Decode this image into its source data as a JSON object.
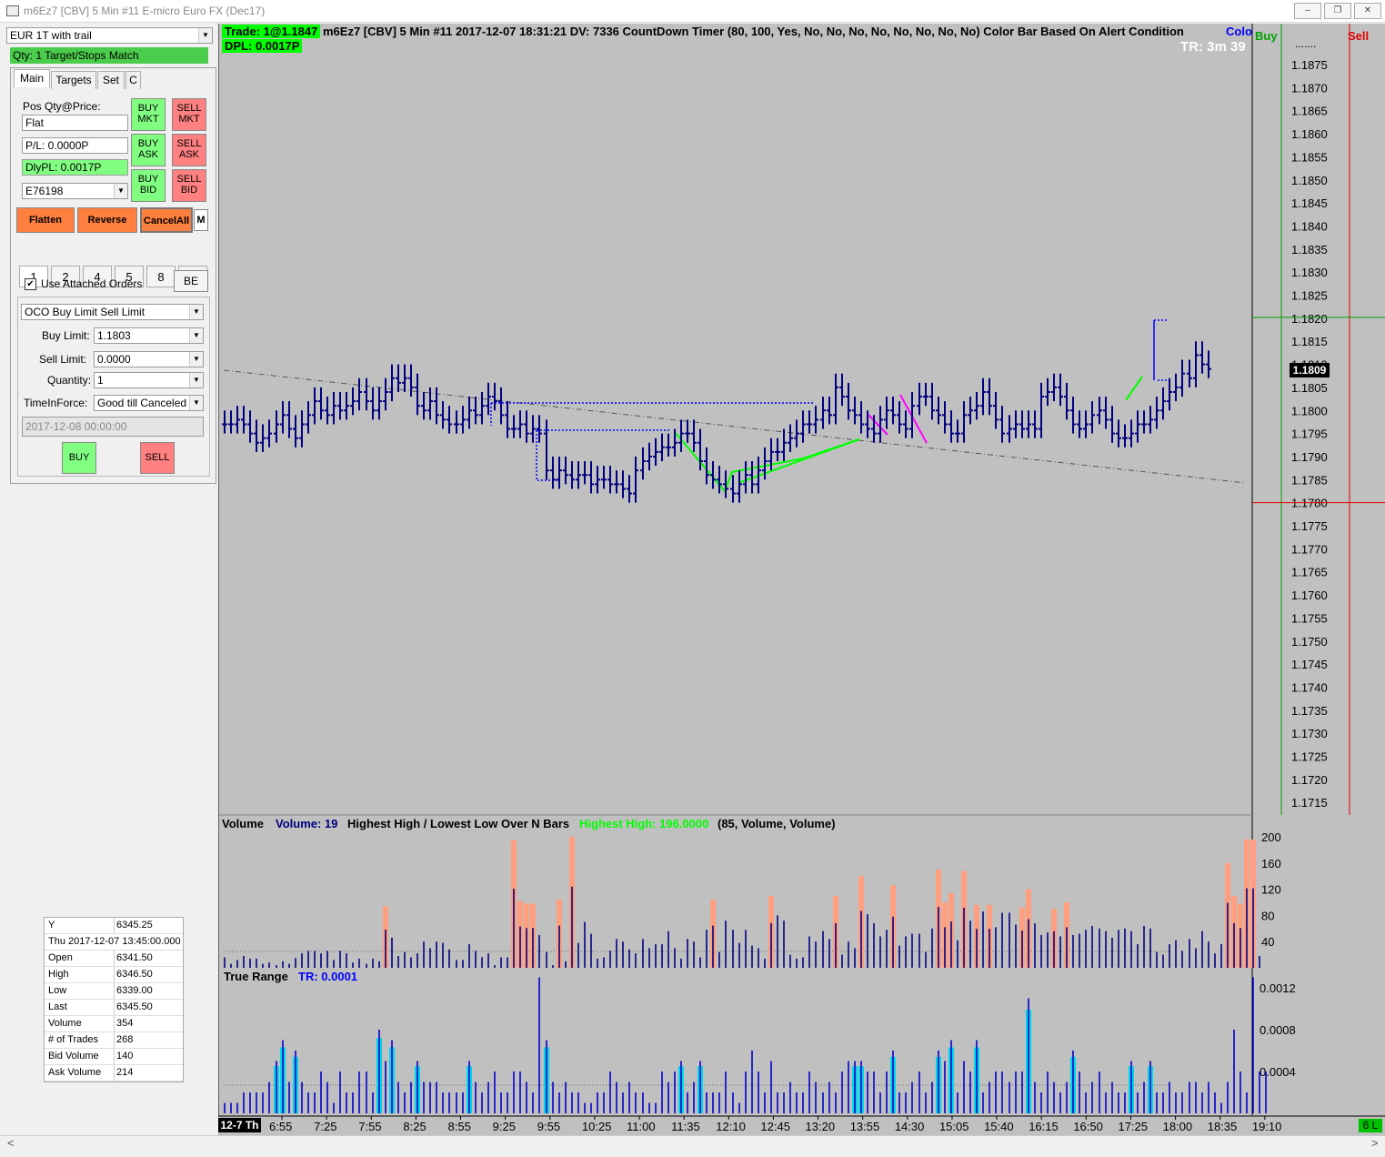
{
  "window": {
    "title": "m6Ez7 [CBV]  5 Min   #11  E-micro Euro FX (Dec17)",
    "buttons": [
      "–",
      "❐",
      "✕"
    ]
  },
  "order_panel": {
    "strategy_select": "EUR 1T with trail",
    "status_bar": "Qty: 1 Target/Stops Match",
    "tabs": [
      "Main",
      "Targets",
      "Set",
      "C"
    ],
    "pos_label": "Pos Qty@Price:",
    "pos_value": "Flat",
    "pl_value": "P/L: 0.0000P",
    "dlypl_value": "DlyPL: 0.0017P",
    "account": "E76198",
    "buy_mkt": [
      "BUY",
      "MKT"
    ],
    "sell_mkt": [
      "SELL",
      "MKT"
    ],
    "buy_ask": [
      "BUY",
      "ASK"
    ],
    "sell_ask": [
      "SELL",
      "ASK"
    ],
    "buy_bid": [
      "BUY",
      "BID"
    ],
    "sell_bid": [
      "SELL",
      "BID"
    ],
    "flatten": "Flatten",
    "reverse": "Reverse",
    "cancel_all": "CancelAll",
    "m_button": "M",
    "qty_buttons": [
      "1",
      "2",
      "4",
      "5",
      "8",
      "0"
    ],
    "use_attached_label": "Use Attached Orders",
    "use_attached_checked": true,
    "be_button": "BE",
    "order_type": "OCO Buy Limit Sell Limit",
    "buy_limit_label": "Buy Limit:",
    "buy_limit_value": "1.1803",
    "sell_limit_label": "Sell Limit:",
    "sell_limit_value": "0.0000",
    "quantity_label": "Quantity:",
    "quantity_value": "1",
    "tif_label": "TimeInForce:",
    "tif_value": "Good till Canceled",
    "date_value": "2017-12-08  00:00:00",
    "buy_button": "BUY",
    "sell_button": "SELL"
  },
  "data_box": {
    "header_k": "Y",
    "header_v": "6345.25",
    "date_row": "Thu 2017-12-07   13:45:00.000",
    "rows": [
      {
        "k": "Open",
        "v": "6341.50"
      },
      {
        "k": "High",
        "v": "6346.50"
      },
      {
        "k": "Low",
        "v": "6339.00"
      },
      {
        "k": "Last",
        "v": "6345.50"
      },
      {
        "k": "Volume",
        "v": "354"
      },
      {
        "k": "# of Trades",
        "v": "268"
      },
      {
        "k": "Bid Volume",
        "v": "140"
      },
      {
        "k": "Ask Volume",
        "v": "214"
      }
    ]
  },
  "chart": {
    "trade_label": "Trade: 1@1.1847",
    "header_text": " m6Ez7 [CBV]  5 Min    #11 2017-12-07  18:31:21 DV: 7336  CountDown Timer    (80, 100, Yes, No, No, No, No, No, No, No, No)  Color Bar Based On Alert Condition",
    "header_trunc": "Colo",
    "dpl_label": "DPL: 0.0017P",
    "timer": "TR: 3m 39",
    "buy_label": "Buy",
    "sell_label": "Sell",
    "current_price": "1.1809",
    "price_axis": [
      "1.1875",
      "1.1870",
      "1.1865",
      "1.1860",
      "1.1855",
      "1.1850",
      "1.1845",
      "1.1840",
      "1.1835",
      "1.1830",
      "1.1825",
      "1.1820",
      "1.1815",
      "1.1810",
      "1.1805",
      "1.1800",
      "1.1795",
      "1.1790",
      "1.1785",
      "1.1780",
      "1.1775",
      "1.1770",
      "1.1765",
      "1.1760",
      "1.1755",
      "1.1750",
      "1.1745",
      "1.1740",
      "1.1735",
      "1.1730",
      "1.1725",
      "1.1720",
      "1.1715"
    ],
    "volume_header": {
      "name": "Volume",
      "study": "Volume: 19",
      "hhll": "Highest High / Lowest Low Over N Bars",
      "hh": "Highest High: 196.0000",
      "params": "(85, Volume, Volume)"
    },
    "volume_axis": [
      "200",
      "160",
      "120",
      "80",
      "40"
    ],
    "tr_header": {
      "name": "True Range",
      "value": "TR: 0.0001"
    },
    "tr_axis": [
      "0.0012",
      "0.0008",
      "0.0004"
    ],
    "time_axis_date": "12-7 Th",
    "time_axis": [
      "6:55",
      "7:25",
      "7:55",
      "8:25",
      "8:55",
      "9:25",
      "9:55",
      "10:25",
      "11:00",
      "11:35",
      "12:10",
      "12:45",
      "13:20",
      "13:55",
      "14:30",
      "15:05",
      "15:40",
      "16:15",
      "16:50",
      "17:25",
      "18:00",
      "18:35",
      "19:10"
    ],
    "corner_label": "6 L",
    "colors": {
      "bg": "#c0c0c0",
      "bar": "#000080",
      "green": "#00ff00",
      "magenta": "#ff00ff",
      "salmon": "#ff9f7f",
      "cyan": "#00d8e8",
      "blue": "#0000ff"
    }
  },
  "chart_data": {
    "type": "bar",
    "title": "m6Ez7 [CBV] 5 Min",
    "xlabel": "",
    "ylabel": "",
    "ylim": [
      1.1715,
      1.1878
    ],
    "series": [
      {
        "name": "Volume: 19",
        "values": [
          16,
          6,
          12,
          18,
          14,
          14,
          6,
          8,
          4,
          10,
          6,
          15,
          22,
          26,
          26,
          22,
          26,
          12,
          26,
          22,
          8,
          14,
          6,
          14,
          10,
          94,
          46,
          18,
          24,
          16,
          22,
          40,
          30,
          40,
          38,
          28,
          12,
          12,
          36,
          26,
          16,
          22,
          4,
          16,
          16,
          195,
          102,
          98,
          98,
          50,
          24,
          4,
          104,
          10,
          200,
          38,
          70,
          52,
          14,
          16,
          26,
          44,
          40,
          28,
          22,
          44,
          30,
          36,
          36,
          56,
          30,
          14,
          44,
          40,
          16,
          58,
          104,
          24,
          72,
          58,
          38,
          58,
          34,
          30,
          14,
          110,
          80,
          72,
          20,
          14,
          16,
          48,
          40,
          56,
          44,
          110,
          20,
          40,
          30,
          140,
          82,
          68,
          48,
          58,
          126,
          34,
          48,
          52,
          52,
          24,
          60,
          150,
          100,
          114,
          42,
          148,
          72,
          96,
          86,
          96,
          62,
          84,
          84,
          66,
          92,
          120,
          68,
          50,
          54,
          90,
          48,
          100,
          50,
          52,
          58,
          64,
          60,
          56,
          46,
          58,
          60,
          56,
          36,
          64,
          60,
          24,
          20,
          36,
          42,
          26,
          44,
          30,
          56,
          40,
          22,
          36,
          160,
          110,
          98,
          196,
          196,
          18
        ]
      },
      {
        "name": "TR: 0.0001",
        "values": [
          0.0001,
          0.0001,
          0.0001,
          0.0002,
          0.0002,
          0.0002,
          0.0002,
          0.0003,
          0.0005,
          0.0007,
          0.0003,
          0.0006,
          0.0003,
          0.0002,
          0.0002,
          0.0004,
          0.0003,
          0.0001,
          0.0004,
          0.0002,
          0.0002,
          0.0004,
          0.0004,
          0.0002,
          0.0008,
          0.0005,
          0.0007,
          0.0003,
          0.0002,
          0.0003,
          0.0005,
          0.0003,
          0.0003,
          0.0003,
          0.0002,
          0.0002,
          0.0002,
          0.0002,
          0.0005,
          0.0003,
          0.0002,
          0.0003,
          0.0004,
          0.0002,
          0.0002,
          0.0004,
          0.0004,
          0.0003,
          0.0002,
          0.0013,
          0.0007,
          0.0003,
          0.0002,
          0.0003,
          0.0002,
          0.0002,
          0.0001,
          0.0001,
          0.0002,
          0.0002,
          0.0004,
          0.0003,
          0.0002,
          0.0003,
          0.0002,
          0.0002,
          0.0001,
          0.0001,
          0.0004,
          0.0003,
          0.0004,
          0.0005,
          0.0002,
          0.0003,
          0.0005,
          0.0002,
          0.0002,
          0.0002,
          0.0004,
          0.0002,
          0.0001,
          0.0004,
          0.0006,
          0.0004,
          0.0002,
          0.0005,
          0.0002,
          0.0002,
          0.0003,
          0.0002,
          0.0002,
          0.0004,
          0.0003,
          0.0002,
          0.0003,
          0.0002,
          0.0004,
          0.0005,
          0.0005,
          0.0005,
          0.0004,
          0.0004,
          0.0002,
          0.0004,
          0.0006,
          0.0002,
          0.0002,
          0.0003,
          0.0004,
          0.0002,
          0.0003,
          0.0006,
          0.0005,
          0.0007,
          0.0002,
          0.0005,
          0.0004,
          0.0007,
          0.0002,
          0.0003,
          0.0004,
          0.0004,
          0.0003,
          0.0004,
          0.0004,
          0.0011,
          0.0003,
          0.0002,
          0.0004,
          0.0003,
          0.0002,
          0.0003,
          0.0006,
          0.0004,
          0.0002,
          0.0003,
          0.0004,
          0.0002,
          0.0003,
          0.0002,
          0.0002,
          0.0005,
          0.0002,
          0.0003,
          0.0005,
          0.0002,
          0.0002,
          0.0003,
          0.0002,
          0.0002,
          0.0003,
          0.0003,
          0.0002,
          0.0003,
          0.0002,
          0.0001,
          0.0003,
          0.0008,
          0.0004,
          0.0002,
          0.0013,
          0.0004,
          0.0004
        ]
      }
    ],
    "price_path": [
      1.1797,
      1.1797,
      1.1798,
      1.1797,
      1.1795,
      1.1793,
      1.1794,
      1.1795,
      1.1797,
      1.1799,
      1.1796,
      1.1794,
      1.1797,
      1.1799,
      1.1802,
      1.18,
      1.1799,
      1.1801,
      1.18,
      1.1801,
      1.1802,
      1.1804,
      1.1802,
      1.18,
      1.1802,
      1.1804,
      1.1807,
      1.1806,
      1.1807,
      1.1805,
      1.1801,
      1.18,
      1.1802,
      1.1799,
      1.1798,
      1.1797,
      1.1797,
      1.1798,
      1.18,
      1.1799,
      1.1801,
      1.1803,
      1.1802,
      1.1799,
      1.1796,
      1.1796,
      1.1797,
      1.1795,
      1.1796,
      1.1795,
      1.1787,
      1.1785,
      1.1787,
      1.1786,
      1.1785,
      1.1786,
      1.1786,
      1.1784,
      1.1785,
      1.1785,
      1.1784,
      1.1784,
      1.1783,
      1.1782,
      1.1787,
      1.1789,
      1.179,
      1.1791,
      1.1792,
      1.1792,
      1.1793,
      1.1795,
      1.1795,
      1.1793,
      1.1789,
      1.1786,
      1.1785,
      1.1784,
      1.1783,
      1.1782,
      1.1784,
      1.1786,
      1.1784,
      1.1787,
      1.1789,
      1.1791,
      1.1791,
      1.1793,
      1.1794,
      1.1795,
      1.1797,
      1.1797,
      1.1798,
      1.18,
      1.1799,
      1.1805,
      1.1803,
      1.18,
      1.1799,
      1.1797,
      1.1796,
      1.1795,
      1.1798,
      1.18,
      1.1799,
      1.1797,
      1.1796,
      1.1801,
      1.1803,
      1.1803,
      1.18,
      1.1799,
      1.1797,
      1.1795,
      1.1795,
      1.1799,
      1.18,
      1.1801,
      1.1804,
      1.1801,
      1.1798,
      1.1795,
      1.1796,
      1.1797,
      1.1796,
      1.1797,
      1.1796,
      1.1803,
      1.1804,
      1.1805,
      1.1803,
      1.18,
      1.1797,
      1.1796,
      1.1797,
      1.1799,
      1.18,
      1.1798,
      1.1795,
      1.1794,
      1.1794,
      1.1795,
      1.1797,
      1.1797,
      1.1798,
      1.18,
      1.1802,
      1.1804,
      1.1805,
      1.1808,
      1.1807,
      1.1812,
      1.181,
      1.1809
    ]
  }
}
